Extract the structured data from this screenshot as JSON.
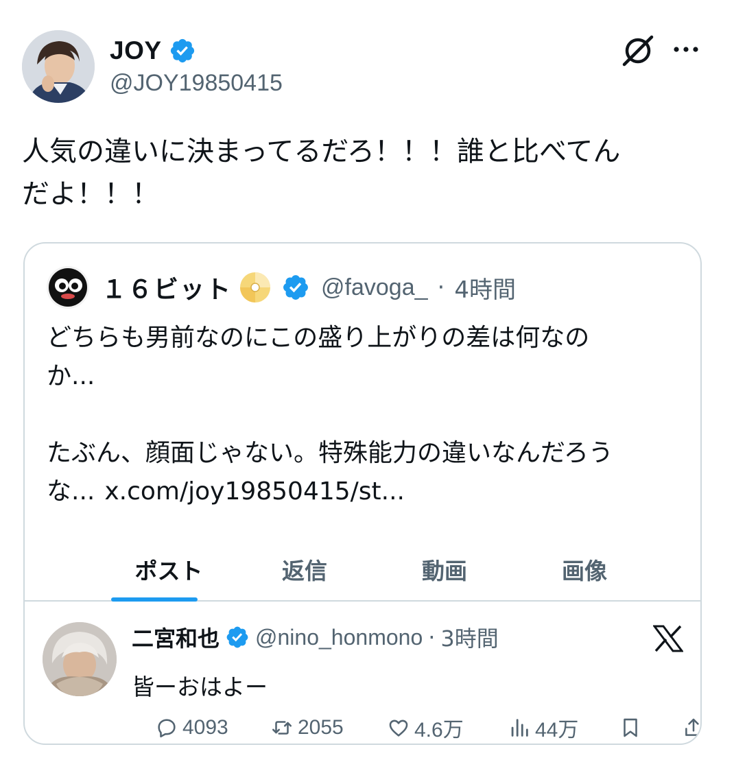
{
  "post": {
    "author": {
      "display_name": "JOY",
      "handle": "@JOY19850415",
      "avatar_icon": "profile-photo",
      "verified": true
    },
    "text_line1": "人気の違いに決まってるだろ！！！誰と比べてん",
    "text_line2": "だよ！！！",
    "header_icons": [
      "grok-icon",
      "more-icon"
    ]
  },
  "quote": {
    "author": {
      "display_name": "１６ビット",
      "handle": "@favoga_",
      "separator": "·",
      "time": "4時間",
      "verified": true
    },
    "text": {
      "line1": "どちらも男前なのにこの盛り上がりの差は何なの",
      "line2": "か...",
      "line3": "たぶん、顔面じゃない。特殊能力の違いなんだろう",
      "line4": "な...",
      "link": "x.com/joy19850415/st..."
    },
    "tabs": [
      {
        "label": "ポスト",
        "active": true
      },
      {
        "label": "返信",
        "active": false
      },
      {
        "label": "動画",
        "active": false
      },
      {
        "label": "画像",
        "active": false
      }
    ],
    "embedded": {
      "display_name": "二宮和也",
      "handle": "@nino_honmono",
      "separator": "·",
      "time": "3時間",
      "text": "皆ーおはよー",
      "actions": {
        "replies": "4093",
        "reposts": "2055",
        "likes": "4.6万",
        "views": "44万"
      }
    }
  },
  "colors": {
    "text": "#0f1419",
    "secondary": "#536471",
    "accent": "#1d9bf0",
    "border": "#cfd9de"
  }
}
